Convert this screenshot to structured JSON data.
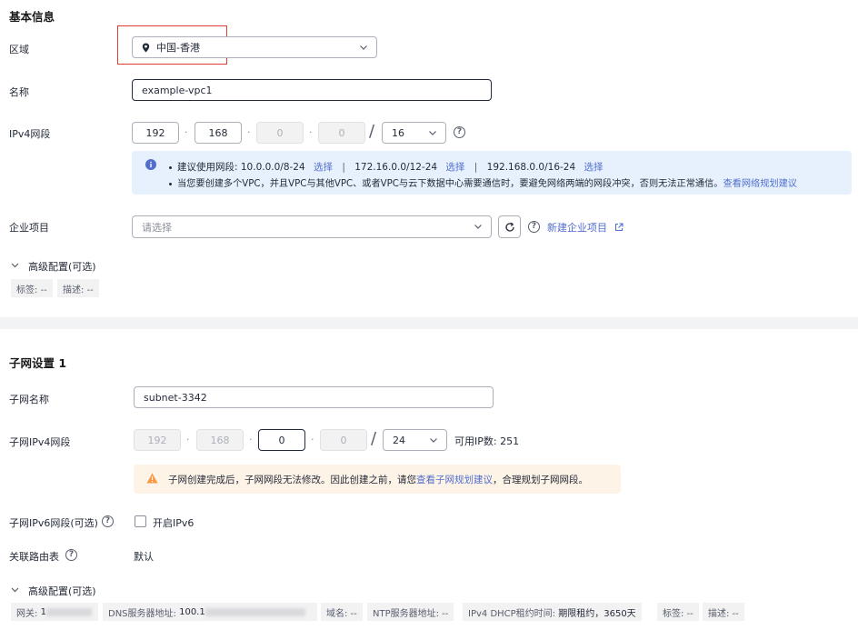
{
  "basic": {
    "title": "基本信息",
    "region_label": "区域",
    "region_value": "中国-香港",
    "name_label": "名称",
    "name_value": "example-vpc1",
    "ipv4_label": "IPv4网段",
    "ipv4": {
      "o1": "192",
      "o2": "168",
      "o3": "0",
      "o4": "0",
      "mask": "16"
    },
    "tips": {
      "line1_prefix": "建议使用网段: 10.0.0.0/8-24",
      "select": "选择",
      "sep": "|",
      "seg2": "172.16.0.0/12-24",
      "seg3": "192.168.0.0/16-24",
      "line2": "当您要创建多个VPC，并且VPC与其他VPC、或者VPC与云下数据中心需要通信时，要避免网络两端的网段冲突，否则无法正常通信。",
      "line2_link": "查看网络规划建议"
    },
    "enterprise_label": "企业项目",
    "enterprise_placeholder": "请选择",
    "new_enterprise": "新建企业项目",
    "advanced_label": "高级配置(可选)",
    "tag_label": "标签: --",
    "desc_label": "描述: --"
  },
  "subnet": {
    "title": "子网设置 1",
    "name_label": "子网名称",
    "name_value": "subnet-3342",
    "ipv4_label": "子网IPv4网段",
    "ipv4": {
      "o1": "192",
      "o2": "168",
      "o3": "0",
      "o4": "0",
      "mask": "24"
    },
    "available_ips": "可用IP数: 251",
    "warning_prefix": "子网创建完成后，子网网段无法修改。因此创建之前，请您",
    "warning_link": "查看子网规划建议",
    "warning_suffix": "，合理规划子网网段。",
    "ipv6_label": "子网IPv6网段(可选)",
    "ipv6_checkbox": "开启IPv6",
    "route_label": "关联路由表",
    "route_value": "默认",
    "advanced_label": "高级配置(可选)",
    "gateway_label": "网关:",
    "gateway_value": "1",
    "dns_label": "DNS服务器地址:",
    "dns_value": "100.1",
    "domain_label": "域名: --",
    "ntp_label": "NTP服务器地址: --",
    "dhcp_label": "IPv4 DHCP租约时间:",
    "dhcp_value": "期限租约，3650天",
    "tag_label": "标签: --",
    "desc_label": "描述: --"
  },
  "colors": {
    "link": "#526ecc",
    "info_bg": "#e6f1fd",
    "warn_bg": "#fdf3e6",
    "highlight": "#e33a35"
  }
}
